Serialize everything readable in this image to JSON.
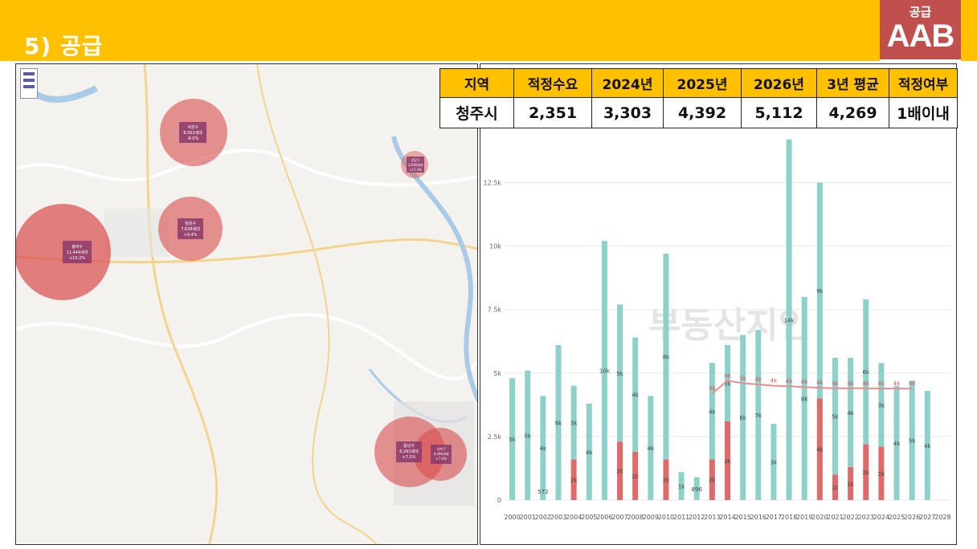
{
  "header": {
    "title": "5) 공급",
    "badge_category": "공급",
    "badge_code": "AAB"
  },
  "colors": {
    "header_bg": "#ffc000",
    "badge_bg": "#c0504d",
    "teal": "#8ed1cb",
    "red": "#e06a6a",
    "avg_line": "#e88e8e"
  },
  "supply_table": {
    "headers": [
      "지역",
      "적정수요",
      "2024년",
      "2025년",
      "2026년",
      "3년 평균",
      "적정여부"
    ],
    "rows": [
      [
        "청주시",
        "2,351",
        "3,303",
        "4,392",
        "5,112",
        "4,269",
        "1배이내"
      ]
    ]
  },
  "map": {
    "bubbles": [
      {
        "name": "서원구",
        "value": "8,562세대",
        "change": "-6.0%"
      },
      {
        "name": "청원구",
        "value": "7,638세대",
        "change": "+9.4%"
      },
      {
        "name": "흥덕구",
        "value": "11,444세대",
        "change": "+10.2%"
      },
      {
        "name": "상당구",
        "value": "3,836세대",
        "change": "+17.3%"
      },
      {
        "name": "동남구",
        "value": "6,291세대",
        "change": "+7.5%"
      },
      {
        "name": "서북구",
        "value": "4,496세대",
        "change": "+7.4%"
      }
    ]
  },
  "chart_data": {
    "type": "bar",
    "title": "",
    "xlabel": "",
    "ylabel": "",
    "ylim": [
      0,
      14000
    ],
    "y_ticks": [
      "0",
      "2.5k",
      "5k",
      "7.5k",
      "10k",
      "12.5k"
    ],
    "categories": [
      "2000",
      "2001",
      "2002",
      "2003",
      "2004",
      "2005",
      "2006",
      "2007",
      "2008",
      "2009",
      "2010",
      "2011",
      "2012",
      "2013",
      "2014",
      "2015",
      "2016",
      "2017",
      "2018",
      "2019",
      "2020",
      "2021",
      "2022",
      "2023",
      "2024",
      "2025",
      "2026",
      "2027",
      "2028"
    ],
    "stacked": true,
    "series": [
      {
        "name": "",
        "color": "#e06a6a",
        "values": [
          0,
          0,
          0,
          0,
          1600,
          0,
          0,
          2300,
          1900,
          0,
          1600,
          0,
          0,
          1600,
          3100,
          0,
          0,
          0,
          0,
          0,
          4000,
          1000,
          1300,
          2200,
          2100,
          0,
          0,
          0,
          0
        ],
        "labels": [
          "",
          "",
          "",
          "",
          "2k",
          "",
          "",
          "2k",
          "2k",
          "",
          "2k",
          "",
          "",
          "2k",
          "3k",
          "",
          "",
          "",
          "",
          "",
          "4k",
          "1k",
          "1k",
          "2k",
          "2k",
          "",
          "",
          "",
          ""
        ]
      },
      {
        "name": "",
        "color": "#8ed1cb",
        "values": [
          4800,
          5100,
          4100,
          6100,
          2900,
          3800,
          10200,
          5400,
          4500,
          4100,
          8100,
          1100,
          896,
          3800,
          3000,
          6500,
          6700,
          3000,
          14200,
          8000,
          8500,
          4600,
          4300,
          5700,
          3300,
          4500,
          4700,
          4300,
          0
        ],
        "labels": [
          "5k",
          "5k",
          "4k",
          "6k",
          "3k",
          "4k",
          "10k",
          "5k",
          "4k",
          "4k",
          "8k",
          "1k",
          "896",
          "4k",
          "3k",
          "6k",
          "7k",
          "3k",
          "14k",
          "8k",
          "9k",
          "5k",
          "4k",
          "6k",
          "3k",
          "4k",
          "5k",
          "4k",
          ""
        ]
      }
    ],
    "special_labels": {
      "2002": "572"
    },
    "average_line": {
      "from": "2013",
      "to": "2026",
      "values": [
        4200,
        4700,
        4600,
        4550,
        4500,
        4480,
        4450,
        4420,
        4400,
        4400,
        4400,
        4390,
        4390,
        4390
      ]
    },
    "average_labels": [
      "4k",
      "4k",
      "5k",
      "4k",
      "4k",
      "4k",
      "4k",
      "4k",
      "4k",
      "4k",
      "4k",
      "4k",
      "4k",
      "4k"
    ],
    "grid": true,
    "watermark": "부동산지인"
  }
}
